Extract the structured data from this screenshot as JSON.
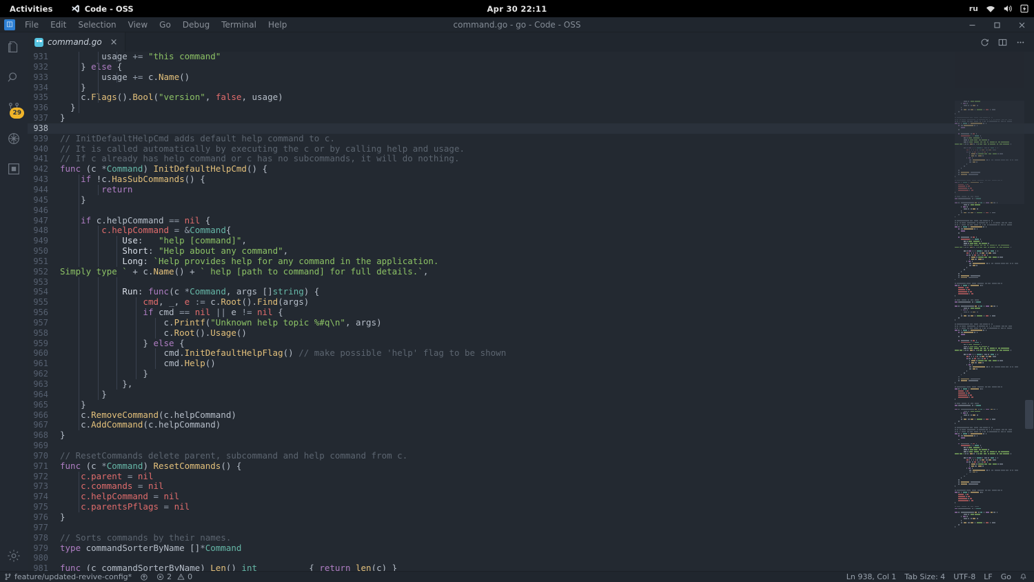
{
  "desktop": {
    "activities_label": "Activities",
    "app_name": "Code - OSS",
    "clock": "Apr 30  22:11",
    "lang_indicator": "ru",
    "tray_icons": [
      "wifi-icon",
      "volume-icon",
      "battery-icon"
    ]
  },
  "titlebar": {
    "window_title": "command.go - go - Code - OSS",
    "menus": [
      "File",
      "Edit",
      "Selection",
      "View",
      "Go",
      "Debug",
      "Terminal",
      "Help"
    ],
    "window_controls": [
      "minimize-button",
      "maximize-button",
      "close-button"
    ]
  },
  "activitybar": {
    "items": [
      {
        "name": "explorer",
        "icon": "files-icon",
        "active": false
      },
      {
        "name": "search",
        "icon": "search-icon",
        "active": false
      },
      {
        "name": "source-control",
        "icon": "source-control-icon",
        "active": false,
        "badge": "29"
      },
      {
        "name": "run-and-debug",
        "icon": "debug-icon",
        "active": false
      },
      {
        "name": "extensions",
        "icon": "extensions-icon",
        "active": false
      }
    ],
    "bottom_items": [
      {
        "name": "manage",
        "icon": "gear-icon"
      }
    ]
  },
  "tabs": {
    "open": [
      {
        "label": "command.go",
        "icon": "go-file-icon",
        "active": true,
        "preview": true,
        "close": "×"
      }
    ],
    "actions": [
      "refresh-icon",
      "split-editor-icon",
      "more-actions-icon"
    ]
  },
  "statusbar": {
    "branch": "feature/updated-revive-config*",
    "sync_icon": "sync-icon",
    "errors_icon": "error-icon",
    "errors": "2",
    "warnings_icon": "warning-icon",
    "warnings": "0",
    "cursor": "Ln 938, Col 1",
    "tab_size": "Tab Size: 4",
    "encoding": "UTF-8",
    "eol": "LF",
    "language": "Go",
    "bell_icon": "bell-icon"
  },
  "editor": {
    "first_line": 931,
    "current_line": 938,
    "colors": {
      "background": "#232931",
      "current_line": "#2a313b",
      "keyword": "#b07ec4",
      "type": "#66b8a8",
      "function": "#e3c07b",
      "string": "#8cc265",
      "comment": "#5c6570",
      "variable": "#e06c6c",
      "plain": "#b6bec9",
      "line_number": "#566070",
      "badge": "#f0b429"
    },
    "lines": [
      {
        "n": 931,
        "indent": 3,
        "t": [
          [
            "pln",
            "        usage "
          ],
          [
            "op",
            "+= "
          ],
          [
            "str",
            "\"this command\""
          ]
        ]
      },
      {
        "n": 932,
        "indent": 2,
        "t": [
          [
            "pln",
            "    } "
          ],
          [
            "kw",
            "else"
          ],
          [
            "pln",
            " {"
          ]
        ]
      },
      {
        "n": 933,
        "indent": 3,
        "t": [
          [
            "pln",
            "        usage "
          ],
          [
            "op",
            "+= "
          ],
          [
            "pln",
            "c."
          ],
          [
            "fn",
            "Name"
          ],
          [
            "pln",
            "()"
          ]
        ]
      },
      {
        "n": 934,
        "indent": 2,
        "t": [
          [
            "pln",
            "    }"
          ]
        ]
      },
      {
        "n": 935,
        "indent": 2,
        "t": [
          [
            "pln",
            "    c."
          ],
          [
            "fn",
            "Flags"
          ],
          [
            "pln",
            "()."
          ],
          [
            "fn",
            "Bool"
          ],
          [
            "pln",
            "("
          ],
          [
            "str",
            "\"version\""
          ],
          [
            "pln",
            ", "
          ],
          [
            "lit",
            "false"
          ],
          [
            "pln",
            ", usage)"
          ]
        ]
      },
      {
        "n": 936,
        "indent": 1,
        "t": [
          [
            "pln",
            "  }"
          ]
        ]
      },
      {
        "n": 937,
        "indent": 0,
        "t": [
          [
            "pln",
            "}"
          ]
        ]
      },
      {
        "n": 938,
        "indent": 0,
        "t": []
      },
      {
        "n": 939,
        "indent": 0,
        "t": [
          [
            "cmt",
            "// InitDefaultHelpCmd adds default help command to c."
          ]
        ]
      },
      {
        "n": 940,
        "indent": 0,
        "t": [
          [
            "cmt",
            "// It is called automatically by executing the c or by calling help and usage."
          ]
        ]
      },
      {
        "n": 941,
        "indent": 0,
        "t": [
          [
            "cmt",
            "// If c already has help command or c has no subcommands, it will do nothing."
          ]
        ]
      },
      {
        "n": 942,
        "indent": 0,
        "t": [
          [
            "kw",
            "func"
          ],
          [
            "pln",
            " (c "
          ],
          [
            "op",
            "*"
          ],
          [
            "typ",
            "Command"
          ],
          [
            "pln",
            ") "
          ],
          [
            "fn",
            "InitDefaultHelpCmd"
          ],
          [
            "pln",
            "() {"
          ]
        ]
      },
      {
        "n": 943,
        "indent": 1,
        "t": [
          [
            "pln",
            "    "
          ],
          [
            "kw",
            "if"
          ],
          [
            "pln",
            " !c."
          ],
          [
            "fn",
            "HasSubCommands"
          ],
          [
            "pln",
            "() {"
          ]
        ]
      },
      {
        "n": 944,
        "indent": 2,
        "t": [
          [
            "pln",
            "        "
          ],
          [
            "kw",
            "return"
          ]
        ]
      },
      {
        "n": 945,
        "indent": 1,
        "t": [
          [
            "pln",
            "    }"
          ]
        ]
      },
      {
        "n": 946,
        "indent": 1,
        "t": []
      },
      {
        "n": 947,
        "indent": 1,
        "t": [
          [
            "pln",
            "    "
          ],
          [
            "kw",
            "if"
          ],
          [
            "pln",
            " c.helpCommand "
          ],
          [
            "op",
            "== "
          ],
          [
            "lit",
            "nil"
          ],
          [
            "pln",
            " {"
          ]
        ]
      },
      {
        "n": 948,
        "indent": 2,
        "t": [
          [
            "pln",
            "        "
          ],
          [
            "var",
            "c.helpCommand"
          ],
          [
            "op",
            " = "
          ],
          [
            "op",
            "&"
          ],
          [
            "typ",
            "Command"
          ],
          [
            "pln",
            "{"
          ]
        ]
      },
      {
        "n": 949,
        "indent": 3,
        "t": [
          [
            "pln",
            "            "
          ],
          [
            "prop",
            "Use"
          ],
          [
            "pln",
            ":   "
          ],
          [
            "str",
            "\"help [command]\""
          ],
          [
            "pln",
            ","
          ]
        ]
      },
      {
        "n": 950,
        "indent": 3,
        "t": [
          [
            "pln",
            "            "
          ],
          [
            "prop",
            "Short"
          ],
          [
            "pln",
            ": "
          ],
          [
            "str",
            "\"Help about any command\""
          ],
          [
            "pln",
            ","
          ]
        ]
      },
      {
        "n": 951,
        "indent": 3,
        "t": [
          [
            "pln",
            "            "
          ],
          [
            "prop",
            "Long"
          ],
          [
            "pln",
            ": "
          ],
          [
            "str",
            "`Help provides help for any command in the application."
          ]
        ]
      },
      {
        "n": 952,
        "indent": 0,
        "t": [
          [
            "str",
            "Simply type `"
          ],
          [
            "pln",
            " + c."
          ],
          [
            "fn",
            "Name"
          ],
          [
            "pln",
            "() + "
          ],
          [
            "str",
            "` help [path to command] for full details.`"
          ],
          [
            "pln",
            ","
          ]
        ]
      },
      {
        "n": 953,
        "indent": 3,
        "t": []
      },
      {
        "n": 954,
        "indent": 3,
        "t": [
          [
            "pln",
            "            "
          ],
          [
            "prop",
            "Run"
          ],
          [
            "pln",
            ": "
          ],
          [
            "kw",
            "func"
          ],
          [
            "pln",
            "(c "
          ],
          [
            "op",
            "*"
          ],
          [
            "typ",
            "Command"
          ],
          [
            "pln",
            ", args []"
          ],
          [
            "typ",
            "string"
          ],
          [
            "pln",
            ") {"
          ]
        ]
      },
      {
        "n": 955,
        "indent": 4,
        "t": [
          [
            "pln",
            "                "
          ],
          [
            "var",
            "cmd"
          ],
          [
            "pln",
            ", "
          ],
          [
            "op",
            "_"
          ],
          [
            "pln",
            ", "
          ],
          [
            "var",
            "e"
          ],
          [
            "pln",
            " "
          ],
          [
            "op",
            ":= "
          ],
          [
            "pln",
            "c."
          ],
          [
            "fn",
            "Root"
          ],
          [
            "pln",
            "()."
          ],
          [
            "fn",
            "Find"
          ],
          [
            "pln",
            "(args)"
          ]
        ]
      },
      {
        "n": 956,
        "indent": 4,
        "t": [
          [
            "pln",
            "                "
          ],
          [
            "kw",
            "if"
          ],
          [
            "pln",
            " cmd "
          ],
          [
            "op",
            "== "
          ],
          [
            "lit",
            "nil"
          ],
          [
            "pln",
            " "
          ],
          [
            "op",
            "|| "
          ],
          [
            "pln",
            "e "
          ],
          [
            "op",
            "!= "
          ],
          [
            "lit",
            "nil"
          ],
          [
            "pln",
            " {"
          ]
        ]
      },
      {
        "n": 957,
        "indent": 5,
        "t": [
          [
            "pln",
            "                    c."
          ],
          [
            "fn",
            "Printf"
          ],
          [
            "pln",
            "("
          ],
          [
            "str",
            "\"Unknown help topic %#q\\n\""
          ],
          [
            "pln",
            ", args)"
          ]
        ]
      },
      {
        "n": 958,
        "indent": 5,
        "t": [
          [
            "pln",
            "                    c."
          ],
          [
            "fn",
            "Root"
          ],
          [
            "pln",
            "()."
          ],
          [
            "fn",
            "Usage"
          ],
          [
            "pln",
            "()"
          ]
        ]
      },
      {
        "n": 959,
        "indent": 4,
        "t": [
          [
            "pln",
            "                } "
          ],
          [
            "kw",
            "else"
          ],
          [
            "pln",
            " {"
          ]
        ]
      },
      {
        "n": 960,
        "indent": 5,
        "t": [
          [
            "pln",
            "                    cmd."
          ],
          [
            "fn",
            "InitDefaultHelpFlag"
          ],
          [
            "pln",
            "() "
          ],
          [
            "cmt",
            "// make possible 'help' flag to be shown"
          ]
        ]
      },
      {
        "n": 961,
        "indent": 5,
        "t": [
          [
            "pln",
            "                    cmd."
          ],
          [
            "fn",
            "Help"
          ],
          [
            "pln",
            "()"
          ]
        ]
      },
      {
        "n": 962,
        "indent": 4,
        "t": [
          [
            "pln",
            "                }"
          ]
        ]
      },
      {
        "n": 963,
        "indent": 3,
        "t": [
          [
            "pln",
            "            },"
          ]
        ]
      },
      {
        "n": 964,
        "indent": 2,
        "t": [
          [
            "pln",
            "        }"
          ]
        ]
      },
      {
        "n": 965,
        "indent": 1,
        "t": [
          [
            "pln",
            "    }"
          ]
        ]
      },
      {
        "n": 966,
        "indent": 1,
        "t": [
          [
            "pln",
            "    c."
          ],
          [
            "fn",
            "RemoveCommand"
          ],
          [
            "pln",
            "(c.helpCommand)"
          ]
        ]
      },
      {
        "n": 967,
        "indent": 1,
        "t": [
          [
            "pln",
            "    c."
          ],
          [
            "fn",
            "AddCommand"
          ],
          [
            "pln",
            "(c.helpCommand)"
          ]
        ]
      },
      {
        "n": 968,
        "indent": 0,
        "t": [
          [
            "pln",
            "}"
          ]
        ]
      },
      {
        "n": 969,
        "indent": 0,
        "t": []
      },
      {
        "n": 970,
        "indent": 0,
        "t": [
          [
            "cmt",
            "// ResetCommands delete parent, subcommand and help command from c."
          ]
        ]
      },
      {
        "n": 971,
        "indent": 0,
        "t": [
          [
            "kw",
            "func"
          ],
          [
            "pln",
            " (c "
          ],
          [
            "op",
            "*"
          ],
          [
            "typ",
            "Command"
          ],
          [
            "pln",
            ") "
          ],
          [
            "fn",
            "ResetCommands"
          ],
          [
            "pln",
            "() {"
          ]
        ]
      },
      {
        "n": 972,
        "indent": 1,
        "t": [
          [
            "pln",
            "    "
          ],
          [
            "var",
            "c.parent"
          ],
          [
            "op",
            " = "
          ],
          [
            "lit",
            "nil"
          ]
        ]
      },
      {
        "n": 973,
        "indent": 1,
        "t": [
          [
            "pln",
            "    "
          ],
          [
            "var",
            "c.commands"
          ],
          [
            "op",
            " = "
          ],
          [
            "lit",
            "nil"
          ]
        ]
      },
      {
        "n": 974,
        "indent": 1,
        "t": [
          [
            "pln",
            "    "
          ],
          [
            "var",
            "c.helpCommand"
          ],
          [
            "op",
            " = "
          ],
          [
            "lit",
            "nil"
          ]
        ]
      },
      {
        "n": 975,
        "indent": 1,
        "t": [
          [
            "pln",
            "    "
          ],
          [
            "var",
            "c.parentsPflags"
          ],
          [
            "op",
            " = "
          ],
          [
            "lit",
            "nil"
          ]
        ]
      },
      {
        "n": 976,
        "indent": 0,
        "t": [
          [
            "pln",
            "}"
          ]
        ]
      },
      {
        "n": 977,
        "indent": 0,
        "t": []
      },
      {
        "n": 978,
        "indent": 0,
        "t": [
          [
            "cmt",
            "// Sorts commands by their names."
          ]
        ]
      },
      {
        "n": 979,
        "indent": 0,
        "t": [
          [
            "kw",
            "type"
          ],
          [
            "pln",
            " commandSorterByName []"
          ],
          [
            "op",
            "*"
          ],
          [
            "typ",
            "Command"
          ]
        ]
      },
      {
        "n": 980,
        "indent": 0,
        "t": []
      },
      {
        "n": 981,
        "indent": 0,
        "t": [
          [
            "kw",
            "func"
          ],
          [
            "pln",
            " (c commandSorterByName) "
          ],
          [
            "fn",
            "Len"
          ],
          [
            "pln",
            "() "
          ],
          [
            "typ",
            "int"
          ],
          [
            "pln",
            "          { "
          ],
          [
            "kw",
            "return"
          ],
          [
            "pln",
            " "
          ],
          [
            "fn",
            "len"
          ],
          [
            "pln",
            "(c) }"
          ]
        ]
      }
    ]
  }
}
